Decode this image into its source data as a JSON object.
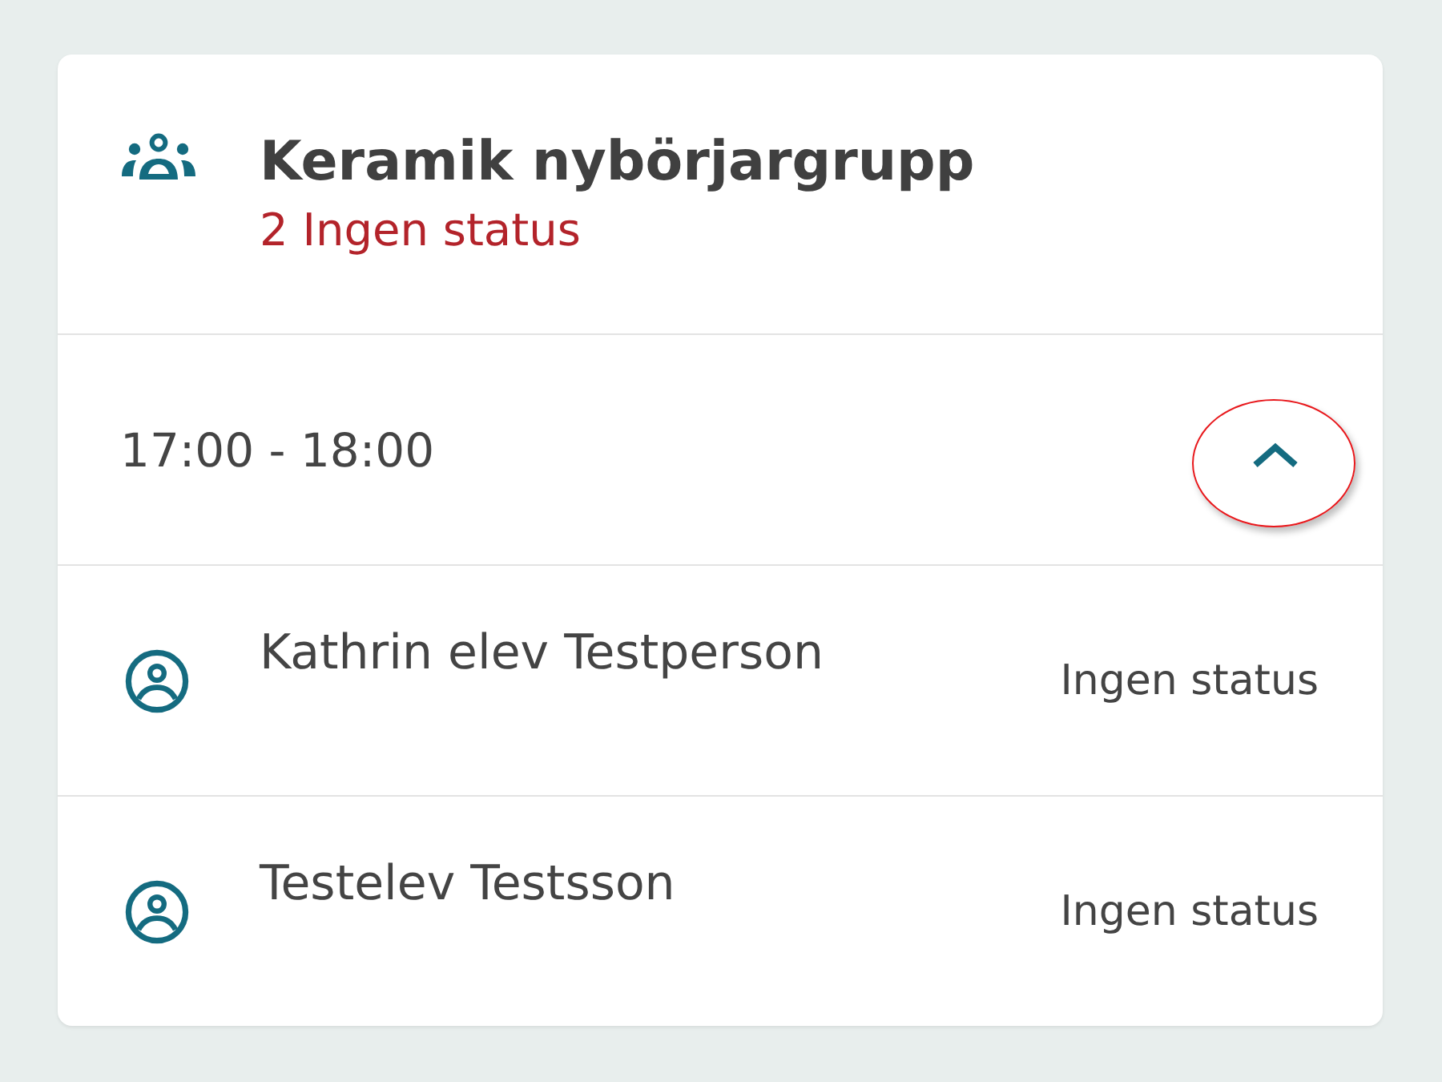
{
  "group": {
    "title": "Keramik nybörjargrupp",
    "summary": "2 Ingen status"
  },
  "session": {
    "time": "17:00 - 18:00",
    "expanded": true,
    "annotated": true
  },
  "students": [
    {
      "name": "Kathrin elev Testperson",
      "status": "Ingen status"
    },
    {
      "name": "Testelev Testsson",
      "status": "Ingen status"
    }
  ]
}
